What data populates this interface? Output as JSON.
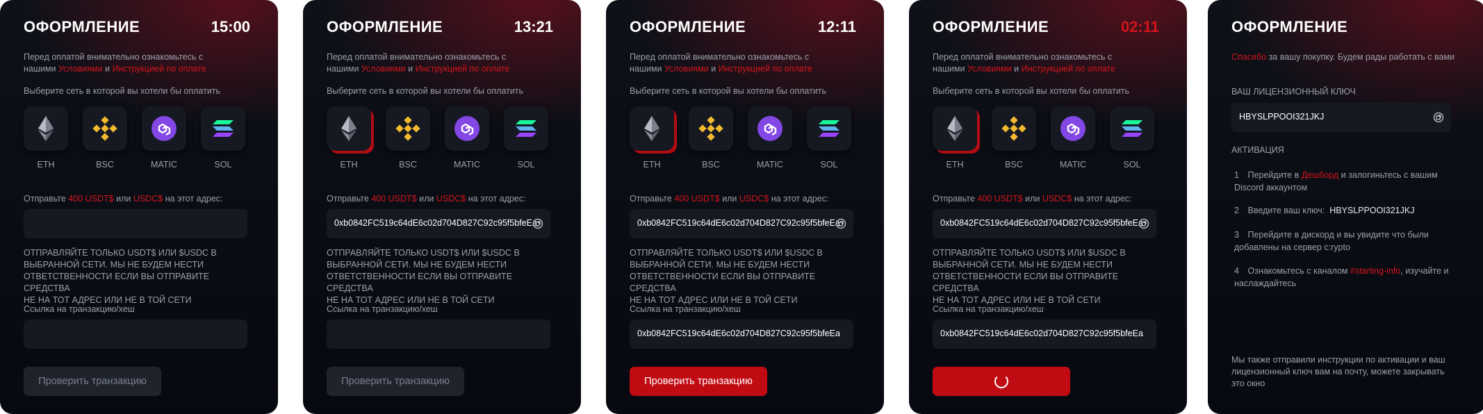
{
  "cards": [
    {
      "title": "ОФОРМЛЕНИЕ",
      "timer": "15:00",
      "address": "",
      "tx": "",
      "button": "Проверить транзакцию"
    },
    {
      "title": "ОФОРМЛЕНИЕ",
      "timer": "13:21",
      "address": "0xb0842FC519c64dE6c02d704D827C92c95f5bfeEa",
      "tx": "",
      "button": "Проверить транзакцию"
    },
    {
      "title": "ОФОРМЛЕНИЕ",
      "timer": "12:11",
      "address": "0xb0842FC519c64dE6c02d704D827C92c95f5bfeEa",
      "tx": "0xb0842FC519c64dE6c02d704D827C92c95f5bfeEa",
      "button": "Проверить транзакцию"
    },
    {
      "title": "ОФОРМЛЕНИЕ",
      "timer": "02:11",
      "address": "0xb0842FC519c64dE6c02d704D827C92c95f5bfeEa",
      "tx": "0xb0842FC519c64dE6c02d704D827C92c95f5bfeEa"
    },
    {
      "title": "ОФОРМЛЕНИЕ"
    }
  ],
  "common": {
    "intro_1": "Перед оплатой внимательно ознакомьтесь с",
    "intro_2": "нашими",
    "terms": "Условиями",
    "and": "и",
    "instructions": "Инструкцией по оплате",
    "choose_network": "Выберите сеть в которой вы хотели бы оплатить",
    "networks": [
      {
        "label": "ETH",
        "icon": "ethereum-icon"
      },
      {
        "label": "BSC",
        "icon": "bnb-icon"
      },
      {
        "label": "MATIC",
        "icon": "polygon-icon"
      },
      {
        "label": "SOL",
        "icon": "solana-icon"
      }
    ],
    "send_prefix": "Отправьте",
    "amount_usdt": "400 USDT$",
    "or": "или",
    "usdc": "USDC$",
    "send_suffix": "на этот адрес:",
    "warning_1": "ОТПРАВЛЯЙТЕ ТОЛЬКО USDT$ ИЛИ $USDC В",
    "warning_2": "ВЫБРАННОЙ СЕТИ. МЫ НЕ БУДЕМ НЕСТИ",
    "warning_3": "ОТВЕТСТВЕННОСТИ ЕСЛИ ВЫ ОТПРАВИТЕ СРЕДСТВА",
    "warning_4": "НЕ НА ТОТ АДРЕС ИЛИ НЕ В ТОЙ СЕТИ",
    "tx_label": "Ссылка на транзакцию/хеш"
  },
  "success": {
    "thanks": "Спасибо",
    "thanks_rest": "за вашу покупку. Будем рады работать с вами",
    "license_label": "ВАШ ЛИЦЕНЗИОННЫЙ КЛЮЧ",
    "license_key": "HBYSLPPOOI321JKJ",
    "activation_label": "АКТИВАЦИЯ",
    "steps": [
      {
        "n": "1",
        "a": "Перейдите в",
        "link": "Дешборд",
        "b": "и залогиньтесь с вашим",
        "c": "Discord аккаунтом"
      },
      {
        "n": "2",
        "a": "Введите ваш ключ:",
        "key": "HBYSLPPOOI321JKJ"
      },
      {
        "n": "3",
        "a": "Перейдите в дискорд и вы увидите что были",
        "c": "добавлены на сервер c:rypto"
      },
      {
        "n": "4",
        "a": "Ознакомьтесь с каналом",
        "link": "#starting-info",
        "b": ", изучайте и",
        "c": "наслаждайтесь"
      }
    ],
    "footer_1": "Мы также отправили инструкции по активации и ваш",
    "footer_2": "лицензионный ключ вам на почту, можете закрывать",
    "footer_3": "это окно"
  },
  "colors": {
    "accent": "#d3141c",
    "button_active": "#c10b13",
    "card_bg": "#0b0d14",
    "field_bg": "#161922"
  }
}
